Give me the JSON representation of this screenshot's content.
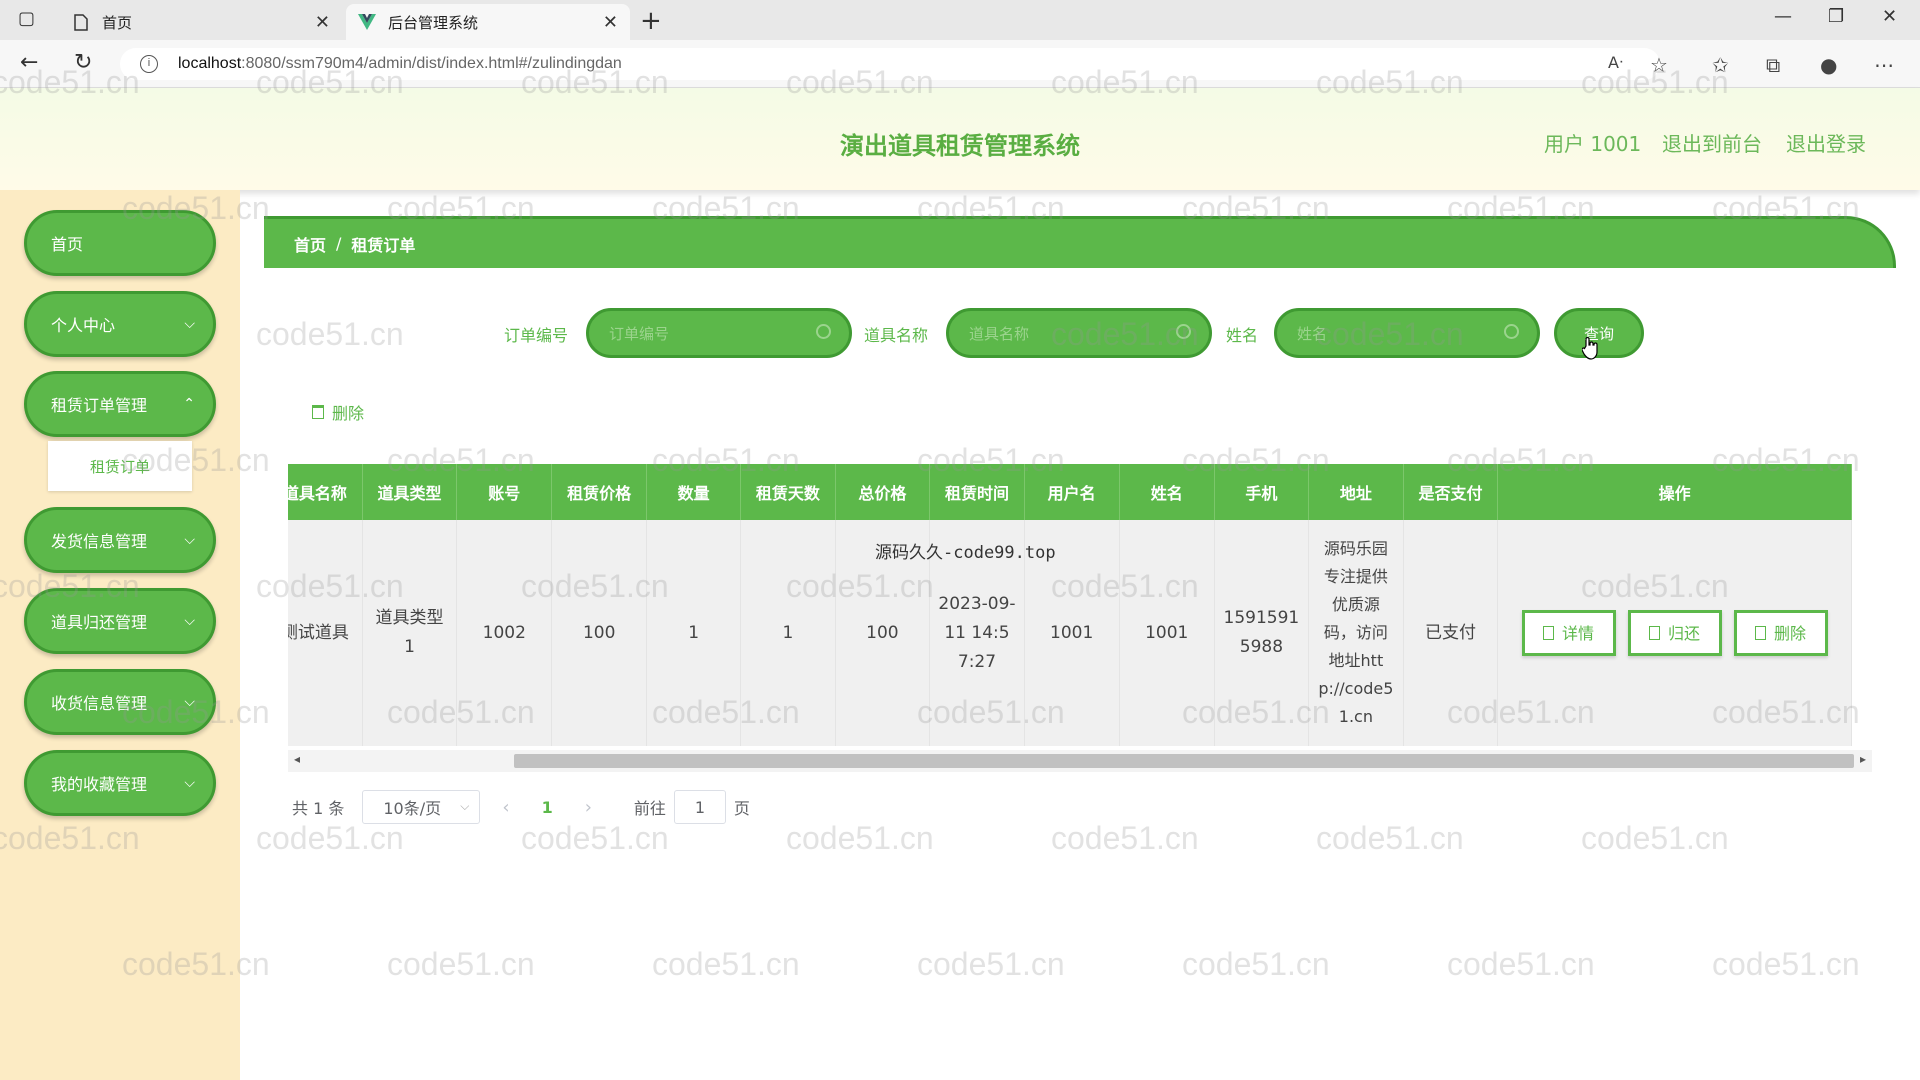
{
  "browser": {
    "tabs": [
      {
        "label": "首页",
        "active": false
      },
      {
        "label": "后台管理系统",
        "active": true
      }
    ],
    "url_host": "localhost",
    "url_path": ":8080/ssm790m4/admin/dist/index.html#/zulindingdan"
  },
  "header": {
    "title": "演出道具租赁管理系统",
    "user": "用户 1001",
    "back_to_front": "退出到前台",
    "logout": "退出登录"
  },
  "sidebar": {
    "items": [
      {
        "label": "首页",
        "has_children": false
      },
      {
        "label": "个人中心",
        "has_children": true
      },
      {
        "label": "租赁订单管理",
        "has_children": true
      },
      {
        "label": "发货信息管理",
        "has_children": true
      },
      {
        "label": "道具归还管理",
        "has_children": true
      },
      {
        "label": "收货信息管理",
        "has_children": true
      },
      {
        "label": "我的收藏管理",
        "has_children": true
      }
    ],
    "active_sub": "租赁订单"
  },
  "breadcrumb": {
    "home": "首页",
    "separator": "/",
    "current": "租赁订单"
  },
  "search": {
    "order_no_label": "订单编号",
    "order_no_placeholder": "订单编号",
    "prop_name_label": "道具名称",
    "prop_name_placeholder": "道具名称",
    "name_label": "姓名",
    "name_placeholder": "姓名",
    "button": "查询"
  },
  "actions": {
    "delete": "删除"
  },
  "table": {
    "columns": [
      "道具名称",
      "道具类型",
      "账号",
      "租赁价格",
      "数量",
      "租赁天数",
      "总价格",
      "租赁时间",
      "用户名",
      "姓名",
      "手机",
      "地址",
      "是否支付",
      "操作"
    ],
    "rows": [
      {
        "prop_name": "测试道具",
        "prop_type": "道具类型1",
        "account": "1002",
        "price": "100",
        "quantity": "1",
        "days": "1",
        "total": "100",
        "time": "2023-09-11 14:57:27",
        "username": "1001",
        "name": "1001",
        "phone": "15915915988",
        "address": "源码乐园专注提供优质源码，访问地址http://code51.cn",
        "paid": "已支付",
        "ops": {
          "detail": "详情",
          "return": "归还",
          "delete": "删除"
        }
      }
    ]
  },
  "overlay_text": "源码久久-code99.top",
  "pagination": {
    "total_text": "共 1 条",
    "page_size": "10条/页",
    "current_page": "1",
    "goto_label": "前往",
    "goto_value": "1",
    "page_suffix": "页"
  },
  "watermark": "code51.cn",
  "colors": {
    "accent": "#5cb84a",
    "accent_dark": "#3f9a32",
    "sidebar_bg": "#fcebc4",
    "title": "#5aae42"
  }
}
